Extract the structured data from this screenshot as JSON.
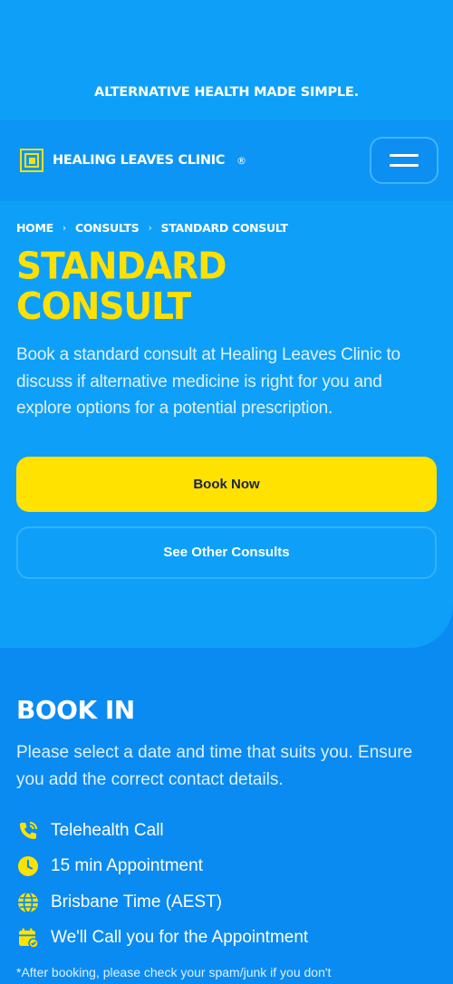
{
  "banner": {
    "tagline": "ALTERNATIVE HEALTH MADE SIMPLE."
  },
  "header": {
    "brand": "HEALING LEAVES CLINIC",
    "registered": "®"
  },
  "breadcrumb": {
    "items": [
      "HOME",
      "CONSULTS",
      "STANDARD CONSULT"
    ]
  },
  "hero": {
    "title_line1": "STANDARD",
    "title_line2": "CONSULT",
    "description": "Book a standard consult at Healing Leaves Clinic to discuss if alternative medicine is right for you and explore options for a potential prescription.",
    "book_label": "Book Now",
    "other_label": "See Other Consults"
  },
  "book": {
    "title": "BOOK IN",
    "description": "Please select a date and time that suits you. Ensure you add the correct contact details.",
    "features": [
      {
        "icon": "phone-icon",
        "label": "Telehealth Call"
      },
      {
        "icon": "clock-icon",
        "label": "15 min Appointment"
      },
      {
        "icon": "globe-icon",
        "label": "Brisbane Time (AEST)"
      },
      {
        "icon": "calendar-check-icon",
        "label": "We'll Call you for the Appointment"
      }
    ],
    "footnote": "*After booking, please check your spam/junk if you don't"
  },
  "colors": {
    "accent": "#ffe200",
    "bg_light": "#0ea0f8",
    "bg_dark": "#0a8bf2"
  }
}
